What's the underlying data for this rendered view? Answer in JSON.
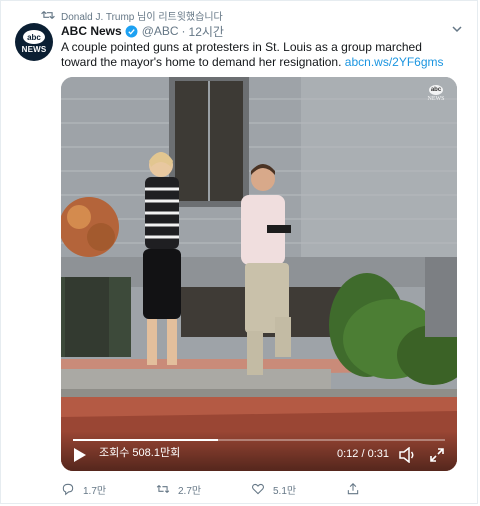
{
  "retweet": {
    "text": "Donald J. Trump 님이 리트윗했습니다",
    "icon": "retweet-icon"
  },
  "author": {
    "name": "ABC News",
    "handle": "@ABC",
    "separator": "·",
    "time": "12시간",
    "avatar_text": "abc",
    "avatar_subtext": "NEWS",
    "verified_icon": "verified-badge-icon"
  },
  "tweet": {
    "text": "A couple pointed guns at protesters in St. Louis as a group marched toward the mayor's home to demand her resignation.",
    "link": "abcn.ws/2YF6gms"
  },
  "video": {
    "watermark_logo": "abc",
    "watermark_text": "NEWS",
    "views": "조회수 508.1만회",
    "timecode": "0:12 / 0:31",
    "progress": 0.39,
    "play_icon": "play-icon",
    "volume_icon": "volume-icon",
    "fullscreen_icon": "fullscreen-icon"
  },
  "actions": {
    "replies": "1.7만",
    "retweets": "2.7만",
    "likes": "5.1만",
    "reply_icon": "reply-icon",
    "retweet_icon": "retweet-icon",
    "like_icon": "heart-icon",
    "share_icon": "share-icon"
  },
  "colors": {
    "link": "#1b95e0",
    "muted": "#657786",
    "verified": "#1da1f2",
    "text": "#14171a"
  }
}
